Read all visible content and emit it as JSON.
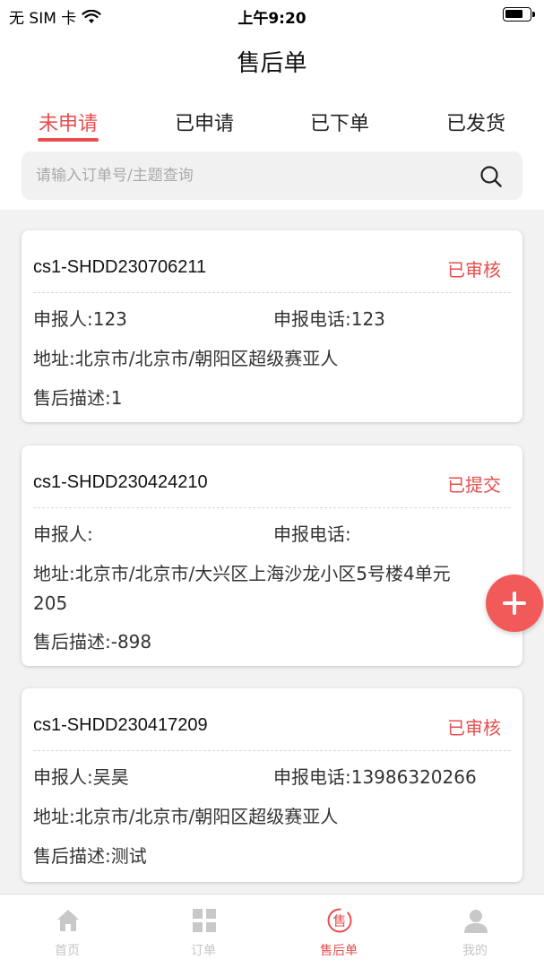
{
  "status_bar": {
    "carrier": "无 SIM 卡",
    "time": "上午9:20"
  },
  "nav": {
    "title": "售后单"
  },
  "tabs": [
    {
      "label": "未申请",
      "active": true
    },
    {
      "label": "已申请",
      "active": false
    },
    {
      "label": "已下单",
      "active": false
    },
    {
      "label": "已发货",
      "active": false
    }
  ],
  "search": {
    "placeholder": "请输入订单号/主题查询",
    "value": ""
  },
  "orders": [
    {
      "order_no": "cs1-SHDD230706211",
      "status": "已审核",
      "reporter": "申报人:123",
      "phone": "申报电话:123",
      "address": "地址:北京市/北京市/朝阳区超级赛亚人",
      "description": "售后描述:1"
    },
    {
      "order_no": "cs1-SHDD230424210",
      "status": "已提交",
      "reporter": "申报人:",
      "phone": "申报电话:",
      "address": "地址:北京市/北京市/大兴区上海沙龙小区5号楼4单元205",
      "description": "售后描述:-898"
    },
    {
      "order_no": "cs1-SHDD230417209",
      "status": "已审核",
      "reporter": "申报人:吴昊",
      "phone": "申报电话:13986320266",
      "address": "地址:北京市/北京市/朝阳区超级赛亚人",
      "description": "售后描述:测试"
    }
  ],
  "tabbar": [
    {
      "label": "首页",
      "icon": "home-icon",
      "active": false
    },
    {
      "label": "订单",
      "icon": "grid-icon",
      "active": false
    },
    {
      "label": "售后单",
      "icon": "after-sale-icon",
      "glyph": "售",
      "active": true
    },
    {
      "label": "我的",
      "icon": "user-icon",
      "active": false
    }
  ],
  "colors": {
    "accent": "#e84e4e",
    "inactive": "#c5c5c5",
    "background": "#f2f2f2"
  }
}
